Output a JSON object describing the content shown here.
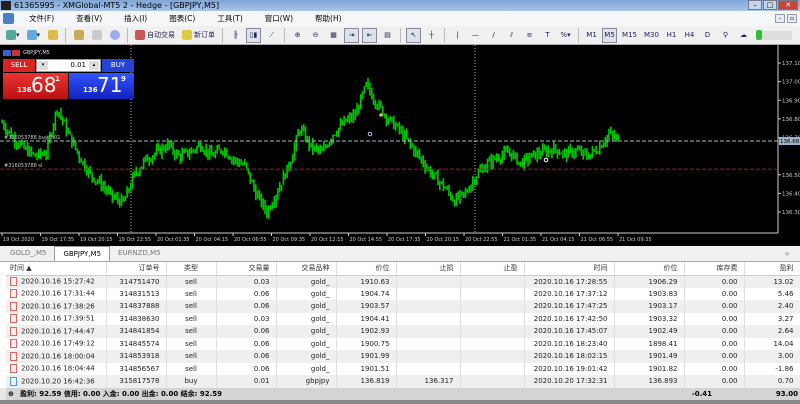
{
  "window": {
    "title": "61365995 - XMGlobal-MT5 2 - Hedge - [GBPJPY,M5]",
    "logo": "MT"
  },
  "menu": [
    "文件(F)",
    "查看(V)",
    "插入(I)",
    "图表(C)",
    "工具(T)",
    "窗口(W)",
    "帮助(H)"
  ],
  "toolbar": {
    "auto_trade": "自动交易",
    "new_order": "新订单",
    "timeframes": [
      "M1",
      "M5",
      "M15",
      "M30",
      "H1",
      "H4",
      "D"
    ],
    "active_timeframe": "M5"
  },
  "trade_panel": {
    "symbol": "GBPJPY,M5",
    "sell": "SELL",
    "buy": "BUY",
    "lot": "0.01",
    "sell_small": "136",
    "sell_big": "68",
    "sell_pip": "1",
    "buy_small": "136",
    "buy_big": "71",
    "buy_pip": "9"
  },
  "chart": {
    "price_labels": [
      "137.100",
      "137.000",
      "136.900",
      "136.800",
      "136.700",
      "136.681",
      "136.500",
      "136.400",
      "136.300"
    ],
    "time_labels": [
      "19 Oct 2020",
      "19 Oct 17:35",
      "19 Oct 20:15",
      "19 Oct 22:55",
      "20 Oct 01:35",
      "20 Oct 04:15",
      "20 Oct 06:55",
      "20 Oct 09:35",
      "20 Oct 12:15",
      "20 Oct 14:55",
      "20 Oct 17:35",
      "20 Oct 20:15",
      "20 Oct 22:55",
      "21 Oct 01:35",
      "21 Oct 04:15",
      "21 Oct 06:55",
      "21 Oct 09:35"
    ],
    "buy_line_label": "#316053788 buy 0.01",
    "sl_line_label": "#316053788 sl",
    "buy_price": 136.681,
    "sl_price": 136.53,
    "prices": [
      136.78,
      136.7,
      136.64,
      136.6,
      136.62,
      136.86,
      136.72,
      136.6,
      136.5,
      136.45,
      136.38,
      136.35,
      136.5,
      136.58,
      136.62,
      136.66,
      136.6,
      136.62,
      136.66,
      136.6,
      136.64,
      136.58,
      136.55,
      136.4,
      136.3,
      136.42,
      136.55,
      136.75,
      136.65,
      136.62,
      136.72,
      136.78,
      136.82,
      136.98,
      136.88,
      136.8,
      136.74,
      136.66,
      136.58,
      136.5,
      136.44,
      136.36,
      136.4,
      136.5,
      136.56,
      136.6,
      136.62,
      136.56,
      136.6,
      136.62,
      136.64,
      136.61,
      136.63,
      136.6,
      136.64,
      136.72,
      136.68
    ],
    "colors": {
      "candle": "#00c800",
      "buy_line": "#9fbfbf",
      "sl_line": "#a02020"
    }
  },
  "tabs": [
    "GOLD_,M5",
    "GBPJPY,M5",
    "EURNZD,M5"
  ],
  "table": {
    "headers": [
      "时间 ▲",
      "订单号",
      "类型",
      "交易量",
      "交易品种",
      "价位",
      "止损",
      "止盈",
      "时间",
      "价位",
      "库存费",
      "盈利"
    ],
    "rows": [
      [
        "2020.10.16 15:27:42",
        "314751470",
        "sell",
        "0.03",
        "gold_",
        "1910.63",
        "",
        "",
        "2020.10.16 17:28:55",
        "1906.29",
        "0.00",
        "13.02"
      ],
      [
        "2020.10.16 17:31:44",
        "314831513",
        "sell",
        "0.06",
        "gold_",
        "1904.74",
        "",
        "",
        "2020.10.16 17:37:12",
        "1903.83",
        "0.00",
        "5.46"
      ],
      [
        "2020.10.16 17:38:26",
        "314837888",
        "sell",
        "0.06",
        "gold_",
        "1903.57",
        "",
        "",
        "2020.10.16 17:47:25",
        "1903.17",
        "0.00",
        "2.40"
      ],
      [
        "2020.10.16 17:39:51",
        "314838630",
        "sell",
        "0.03",
        "gold_",
        "1904.41",
        "",
        "",
        "2020.10.16 17:42:50",
        "1903.32",
        "0.00",
        "3.27"
      ],
      [
        "2020.10.16 17:44:47",
        "314841854",
        "sell",
        "0.06",
        "gold_",
        "1902.93",
        "",
        "",
        "2020.10.16 17:45:07",
        "1902.49",
        "0.00",
        "2.64"
      ],
      [
        "2020.10.16 17:49:12",
        "314845574",
        "sell",
        "0.06",
        "gold_",
        "1900.75",
        "",
        "",
        "2020.10.16 18:23:40",
        "1898.41",
        "0.00",
        "14.04"
      ],
      [
        "2020.10.16 18:00:04",
        "314853918",
        "sell",
        "0.06",
        "gold_",
        "1901.99",
        "",
        "",
        "2020.10.16 18:02:15",
        "1901.49",
        "0.00",
        "3.00"
      ],
      [
        "2020.10.16 18:04:44",
        "314856567",
        "sell",
        "0.06",
        "gold_",
        "1901.51",
        "",
        "",
        "2020.10.16 19:01:42",
        "1901.82",
        "0.00",
        "-1.86"
      ],
      [
        "2020.10.20 16:42:36",
        "315817578",
        "buy",
        "0.01",
        "gbpjpy",
        "136.819",
        "136.317",
        "",
        "2020.10.20 17:32:31",
        "136.893",
        "0.00",
        "0.70"
      ]
    ]
  },
  "footer": {
    "summary": "盈利: 92.59  信用: 0.00  入金: 0.00  出金: 0.00  结余: 92.59",
    "swap_total": "-0.41",
    "profit_total": "93.00"
  }
}
